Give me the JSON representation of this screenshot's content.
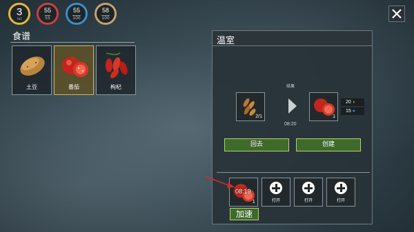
{
  "stats": {
    "level": {
      "value": "3",
      "sub": "lvl",
      "color": "#e1b93a"
    },
    "health": {
      "value": "55",
      "max": "55",
      "color": "#c94040"
    },
    "water": {
      "value": "55",
      "max": "100",
      "color": "#3a8fc9"
    },
    "food": {
      "value": "58",
      "max": "100",
      "color": "#c9a070"
    }
  },
  "recipes": {
    "title": "食谱",
    "items": [
      {
        "label": "土豆",
        "icon": "potato-icon",
        "selected": false
      },
      {
        "label": "番茄",
        "icon": "tomato-icon",
        "selected": true
      },
      {
        "label": "枸杞",
        "icon": "goji-icon",
        "selected": false
      }
    ]
  },
  "greenhouse": {
    "title": "温室",
    "input": {
      "icon": "seeds-icon",
      "quantity": "2/1"
    },
    "result_label": "结果",
    "timer": "08:20",
    "output": {
      "icon": "tomato-icon",
      "quantity": "1"
    },
    "yields": [
      {
        "value": "20",
        "icon": "food-icon",
        "color": "#e09a4a"
      },
      {
        "value": "15",
        "icon": "water-icon",
        "color": "#3a8fc9"
      }
    ],
    "back_label": "回去",
    "create_label": "创建",
    "queue": [
      {
        "type": "active",
        "icon": "tomato-icon",
        "timer": "08:19",
        "quantity": "1"
      },
      {
        "type": "empty",
        "label": "打开"
      },
      {
        "type": "empty",
        "label": "打开"
      },
      {
        "type": "empty",
        "label": "打开"
      }
    ],
    "speed_up_label": "加速"
  },
  "colors": {
    "button_green": "#3e6a2b",
    "selected_gold": "#d6b85a",
    "pointer_red": "#d62b2b"
  }
}
